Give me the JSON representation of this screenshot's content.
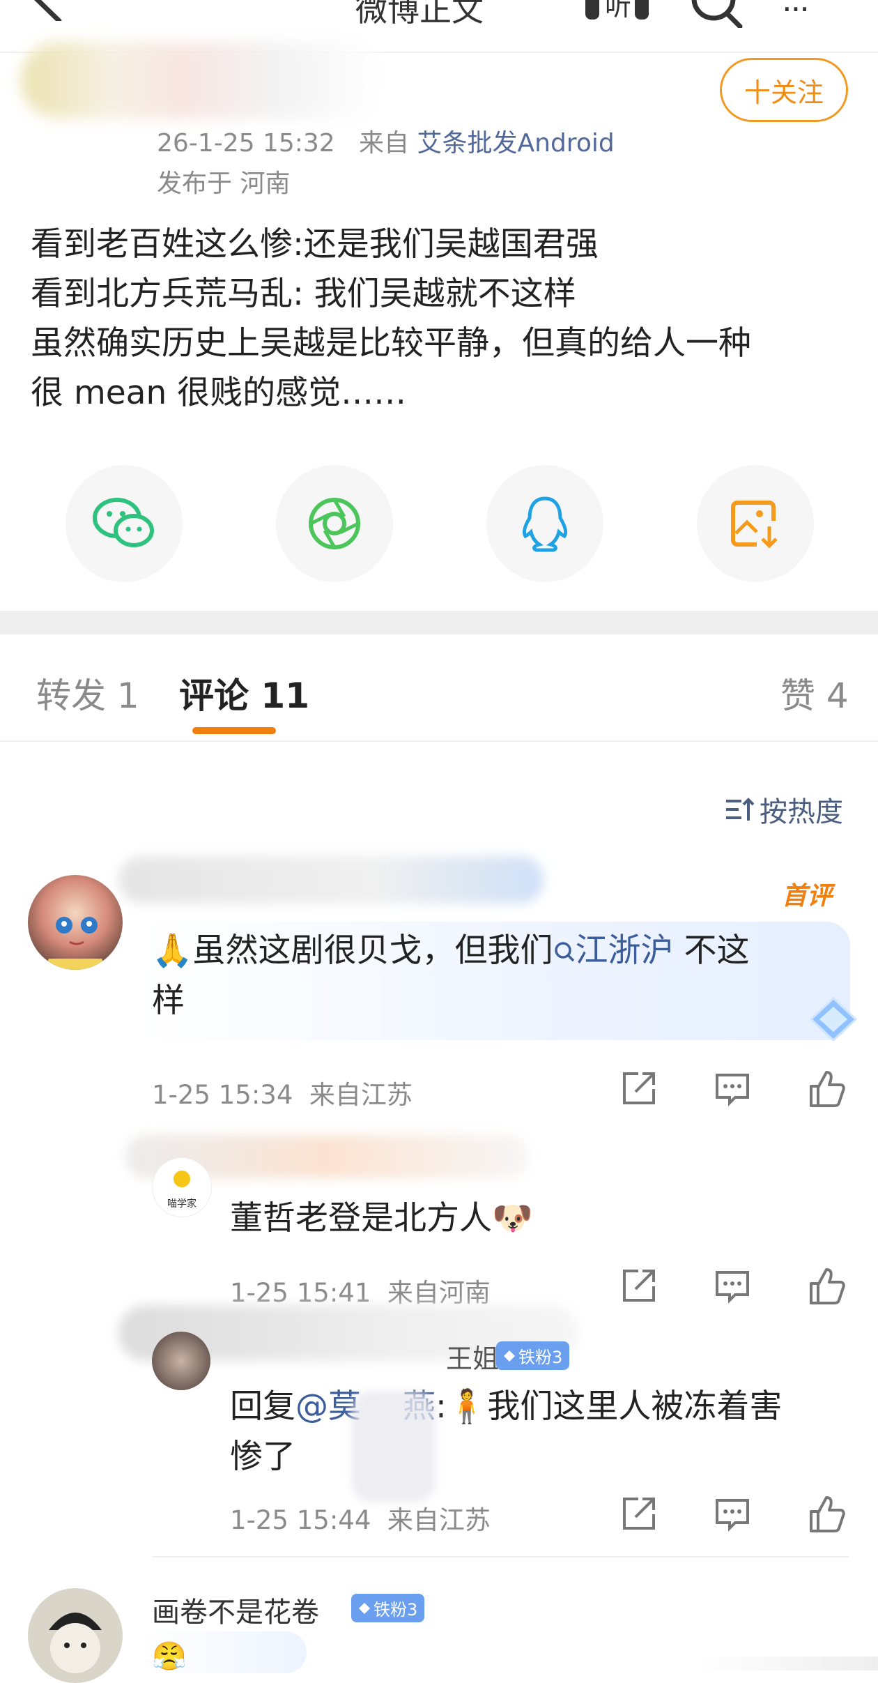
{
  "header": {
    "title": "微博正文",
    "more": "···"
  },
  "post": {
    "follow_label": "十关注",
    "time": "26-1-25 15:32",
    "from_label": "来自",
    "source": "艾条批发Android",
    "location": "发布于 河南",
    "lines": [
      "看到老百姓这么惨:还是我们吴越国君强",
      "看到北方兵荒马乱: 我们吴越就不这样",
      "虽然确实历史上吴越是比较平静，但真的给人一种",
      "很 mean 很贱的感觉……"
    ]
  },
  "share": [
    {
      "icon": "wechat-icon",
      "color": "#2ec27e"
    },
    {
      "icon": "moments-icon",
      "color": "#4cc65b"
    },
    {
      "icon": "qq-icon",
      "color": "#1ea2e3"
    },
    {
      "icon": "save-image-icon",
      "color": "#f59a1a"
    }
  ],
  "tabs": {
    "repost": "转发 1",
    "comments": "评论 11",
    "likes": "赞 4"
  },
  "sort_label": "按热度",
  "comments": [
    {
      "badge_first": "首评",
      "text_prefix": "🙏虽然这剧很贝戈，但我们",
      "topic": "江浙沪",
      "text_suffix": " 不这",
      "text_line2": "样",
      "time": "1-25 15:34",
      "location": "来自江苏"
    },
    {
      "avatar_label": "喵学家",
      "text": "董哲老登是北方人🐶",
      "time": "1-25 15:41",
      "location": "来自河南"
    },
    {
      "name_visible": "王姐",
      "badge": "铁粉3",
      "reply_prefix": "回复",
      "mention": "@莫",
      "mention_end": "燕",
      "reply_text": ":🧍我们这里人被冻着害",
      "reply_line2": "惨了",
      "time": "1-25 15:44",
      "location": "来自江苏"
    },
    {
      "name": "画卷不是花卷",
      "badge": "铁粉3",
      "emoji": "😤"
    }
  ]
}
